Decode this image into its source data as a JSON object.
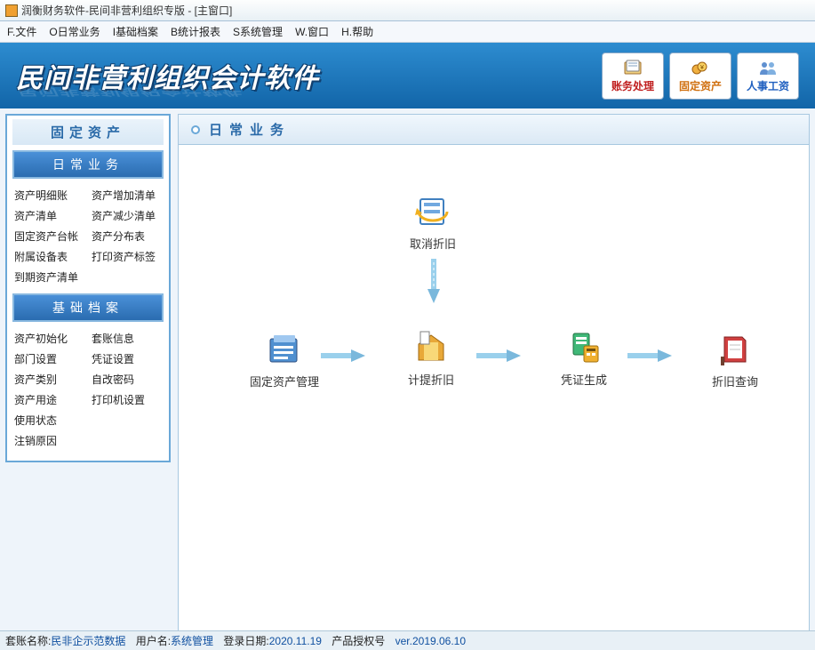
{
  "title": "润衡财务软件-民间非营利组织专版 - [主窗口]",
  "menu": [
    "F.文件",
    "O日常业务",
    "I基础档案",
    "B统计报表",
    "S系统管理",
    "W.窗口",
    "H.帮助"
  ],
  "banner": {
    "title": "民间非营利组织会计软件",
    "buttons": [
      {
        "label": "账务处理"
      },
      {
        "label": "固定资产"
      },
      {
        "label": "人事工资"
      }
    ]
  },
  "sidebar": {
    "title": "固定资产",
    "sections": [
      {
        "header": "日常业务",
        "links": [
          "资产明细账",
          "资产增加清单",
          "资产清单",
          "资产减少清单",
          "固定资产台帐",
          "资产分布表",
          "附属设备表",
          "打印资产标签",
          "到期资产清单"
        ]
      },
      {
        "header": "基础档案",
        "links": [
          "资产初始化",
          "套账信息",
          "部门设置",
          "凭证设置",
          "资产类别",
          "自改密码",
          "资产用途",
          "打印机设置",
          "使用状态",
          "",
          "注销原因",
          ""
        ]
      }
    ]
  },
  "main": {
    "title": "日常业务",
    "nodes": {
      "cancel": "取消折旧",
      "manage": "固定资产管理",
      "calc": "计提折旧",
      "voucher": "凭证生成",
      "query": "折旧查询"
    }
  },
  "status": {
    "l1": "套账名称:",
    "v1": "民非企示范数据",
    "l2": "用户名:",
    "v2": "系统管理",
    "l3": "登录日期:",
    "v3": "2020.11.19",
    "l4": "产品授权号",
    "v4": "ver.2019.06.10"
  }
}
